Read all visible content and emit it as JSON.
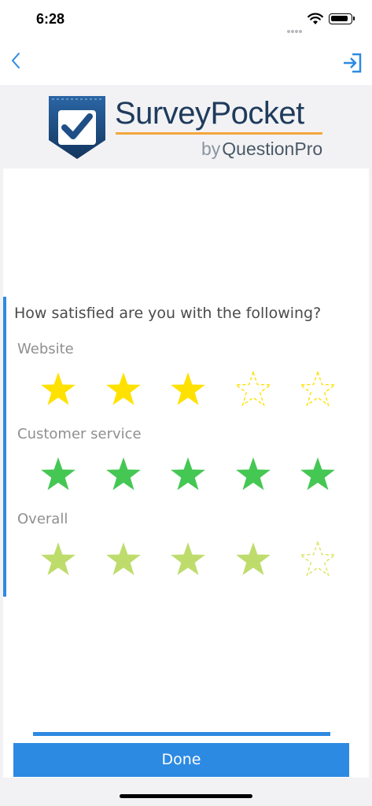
{
  "status_bar": {
    "time": "6:28"
  },
  "logo": {
    "word1": "Survey",
    "word2": "Pocket",
    "by": "by",
    "brand": "QuestionPro"
  },
  "question": {
    "text": "How satisfied are you with the following?",
    "rows": [
      {
        "label": "Website",
        "rating": 3,
        "max": 5,
        "color": "#ffe100",
        "empty_color": "#ffe100"
      },
      {
        "label": "Customer service",
        "rating": 5,
        "max": 5,
        "color": "#45c753",
        "empty_color": "#45c753"
      },
      {
        "label": "Overall",
        "rating": 4,
        "max": 5,
        "color": "#bedc6c",
        "empty_color": "#d9e45a"
      }
    ]
  },
  "footer": {
    "done_label": "Done"
  },
  "colors": {
    "accent": "#2d8ae2",
    "logo_navy": "#1f3b5c",
    "logo_orange": "#f3a73b"
  },
  "icons": {
    "back": "chevron-left-icon",
    "exit": "exit-icon"
  }
}
